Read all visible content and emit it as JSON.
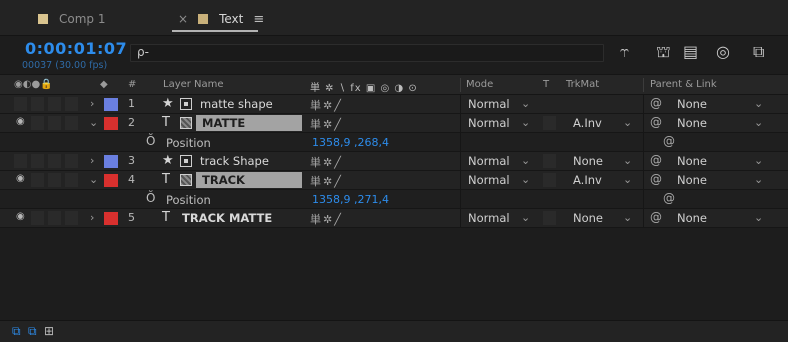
{
  "tabs": [
    {
      "label": "Comp 1",
      "color": "#d9c48f"
    },
    {
      "label": "Text",
      "color": "#c8b07a",
      "close": "×",
      "menu": "≡"
    }
  ],
  "timecode": "0:00:01:07",
  "fps_readout": "00037 (30.00 fps)",
  "search": {
    "placeholder": "ρ-"
  },
  "columns": {
    "layer_name": "Layer Name",
    "hash": "#",
    "switches": "単 ✲ ∖ fx ▣ ◎ ◑ ⊙",
    "mode": "Mode",
    "t": "T",
    "trkmat": "TrkMat",
    "parent": "Parent & Link"
  },
  "colors": {
    "accent": "#2d8ceb",
    "label_blue": "#6a7fe0",
    "label_red": "#d8302e"
  },
  "layers": [
    {
      "num": "1",
      "type": "★",
      "name": "matte shape",
      "label_color": "#6a7fe0",
      "mode": "Normal",
      "trkmat": "",
      "parent": "None",
      "visible": false,
      "expanded": false,
      "selected": false
    },
    {
      "num": "2",
      "type": "T",
      "name": "MATTE",
      "label_color": "#d8302e",
      "mode": "Normal",
      "trkmat": "A.Inv",
      "parent": "None",
      "visible": true,
      "expanded": true,
      "selected": true,
      "property": {
        "name": "Position",
        "value": "1358,9 ,268,4"
      }
    },
    {
      "num": "3",
      "type": "★",
      "name": "track Shape",
      "label_color": "#6a7fe0",
      "mode": "Normal",
      "trkmat": "None",
      "parent": "None",
      "visible": false,
      "expanded": false,
      "selected": false
    },
    {
      "num": "4",
      "type": "T",
      "name": "TRACK",
      "label_color": "#d8302e",
      "mode": "Normal",
      "trkmat": "A.Inv",
      "parent": "None",
      "visible": true,
      "expanded": true,
      "selected": true,
      "property": {
        "name": "Position",
        "value": "1358,9 ,271,4"
      }
    },
    {
      "num": "5",
      "type": "T",
      "name": "TRACK MATTE",
      "label_color": "#d8302e",
      "mode": "Normal",
      "trkmat": "None",
      "parent": "None",
      "visible": true,
      "expanded": false,
      "selected": false
    }
  ]
}
